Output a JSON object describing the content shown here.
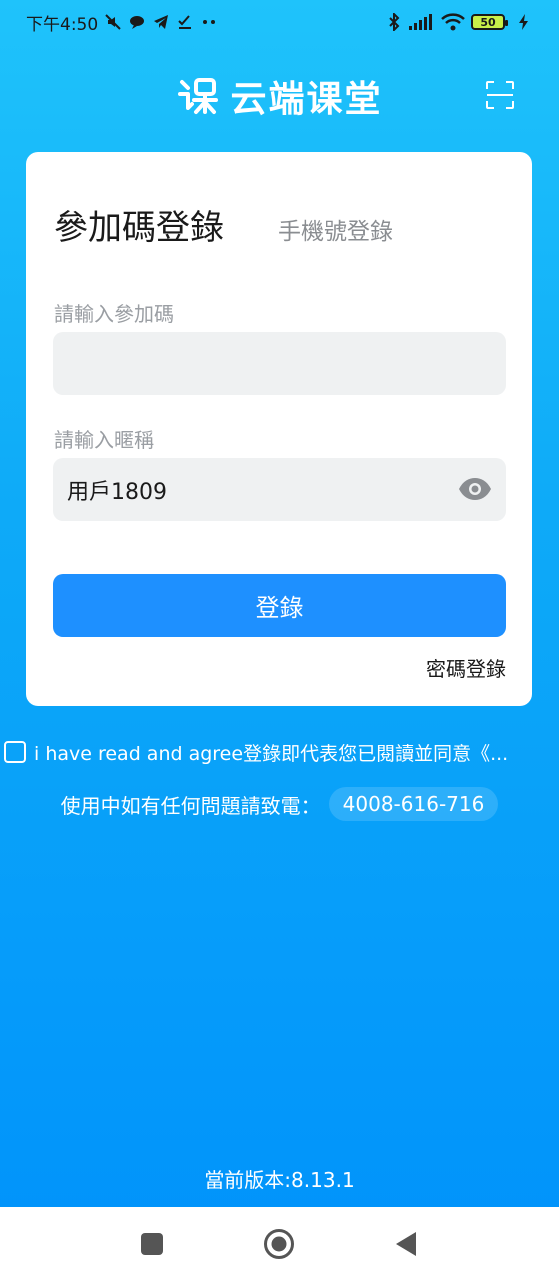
{
  "status_bar": {
    "time": "下午4:50",
    "battery_level": "50",
    "icons_left": [
      "mute-icon",
      "chat-bubble-icon",
      "telegram-icon",
      "task-check-icon",
      "more-dots-icon"
    ],
    "icons_right": [
      "bluetooth-icon",
      "signal-icon",
      "wifi-icon",
      "battery-icon",
      "charging-icon"
    ]
  },
  "header": {
    "app_name": "云端课堂",
    "logo_icon": "cloud-classroom-logo-icon",
    "scan_icon": "scan-icon"
  },
  "login_card": {
    "tabs": [
      {
        "label": "參加碼登錄",
        "active": true
      },
      {
        "label": "手機號登錄",
        "active": false
      }
    ],
    "code_field": {
      "label": "請輸入參加碼",
      "value": ""
    },
    "nickname_field": {
      "label": "請輸入暱稱",
      "value": "用戶1809",
      "icon": "eye-icon"
    },
    "login_button": "登錄",
    "password_login_link": "密碼登錄"
  },
  "agreement": {
    "checked": false,
    "text": "i have read and agree登錄即代表您已閱讀並同意《..."
  },
  "support": {
    "text": "使用中如有任何問題請致電：",
    "phone": "4008-616-716"
  },
  "version": "當前版本:8.13.1",
  "nav_bar": {
    "items": [
      "recents-square-icon",
      "home-circle-icon",
      "back-triangle-icon"
    ]
  },
  "colors": {
    "gradient_top": "#1fc3fb",
    "gradient_bottom": "#0092fb",
    "primary_button": "#1e90ff",
    "input_bg": "#eff1f2"
  }
}
